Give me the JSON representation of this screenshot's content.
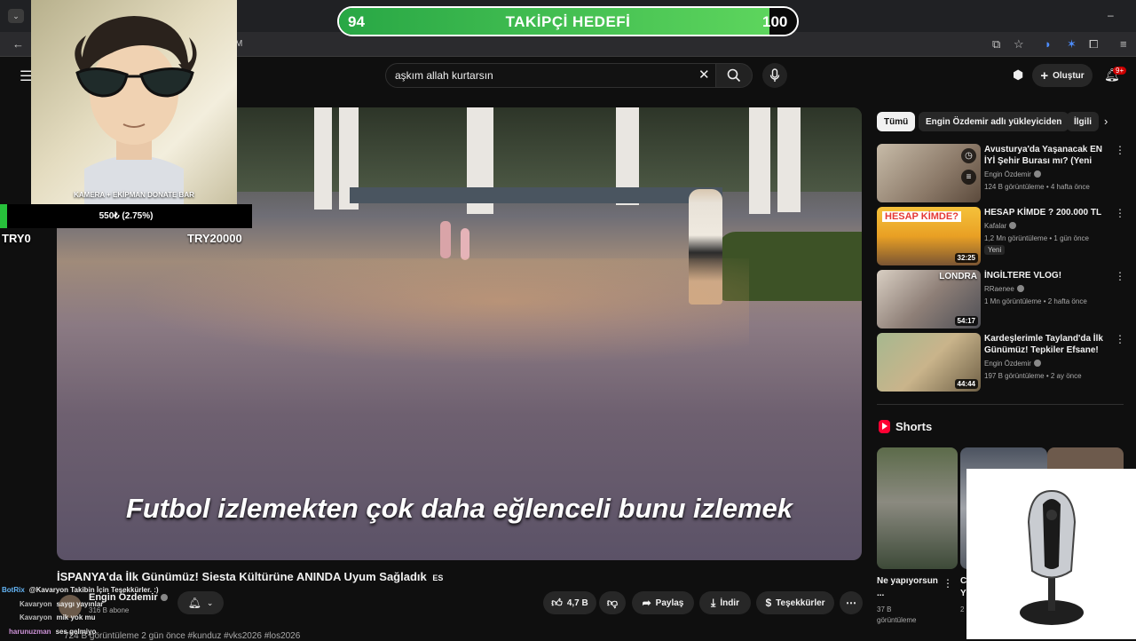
{
  "browser": {
    "address_suffix": "M"
  },
  "goal": {
    "title": "TAKİPÇİ HEDEFİ",
    "current": "94",
    "target": "100",
    "progress": 0.94
  },
  "search": {
    "query": "aşkım allah kurtarsın"
  },
  "header": {
    "create_label": "Oluştur",
    "notif_count": "9+"
  },
  "overlay": {
    "cam_caption": "KAMERA + EKİPMAN DONATE BAR",
    "donate_amount": "550₺ (2.75%)",
    "donate_progress": 0.0275,
    "min_label": "TRY0",
    "max_label": "TRY20000"
  },
  "video": {
    "subtitle": "Futbol izlemekten çok daha eğlenceli bunu izlemek",
    "title": "İSPANYA'da İlk Günümüz! Siesta Kültürüne ANINDA Uyum Sağladık",
    "title_suffix": "ES",
    "channel": "Engin Özdemir",
    "subscribers": "316 B abone",
    "description": "724 B görüntüleme  2 gün önce  #kunduz #vks2026 #los2026",
    "actions": {
      "likes": "4,7 B",
      "share": "Paylaş",
      "download": "İndir",
      "thanks": "Teşekkürler"
    }
  },
  "chips": [
    "Tümü",
    "Engin Özdemir adlı yükleyiciden",
    "İlgili"
  ],
  "recommendations": [
    {
      "title": "Avusturya'da Yaşanacak EN İYİ Şehir Burası mı? (Yeni Evimiz ...",
      "channel": "Engin Özdemir",
      "meta": "124 B görüntüleme • 4 hafta önce",
      "duration": "",
      "badge": ""
    },
    {
      "title": "HESAP KİMDE ? 200.000 TL",
      "channel": "Kafalar",
      "meta": "1,2 Mn görüntüleme • 1 gün önce",
      "duration": "32:25",
      "badge": "Yeni"
    },
    {
      "title": "İNGİLTERE VLOG!",
      "channel": "RRaenee",
      "meta": "1 Mn görüntüleme • 2 hafta önce",
      "duration": "54:17",
      "badge": ""
    },
    {
      "title": "Kardeşlerimle Tayland'da İlk Günümüz! Tepkiler Efsane!",
      "channel": "Engin Özdemir",
      "meta": "197 B görüntüleme • 2 ay önce",
      "duration": "44:44",
      "badge": ""
    }
  ],
  "thumb_texts": {
    "hesap": "HESAP KİMDE?",
    "londra": "LONDRA"
  },
  "shorts": {
    "heading": "Shorts",
    "items": [
      {
        "title": "Ne yapıyorsun ...",
        "views": "37 B görüntüleme"
      },
      {
        "title": "C Y",
        "views": "2"
      }
    ]
  },
  "chat": [
    {
      "user": "BotRix",
      "msg": "@Kavaryon Takibin İçin Teşekkürler. :)"
    },
    {
      "user": "Kavaryon",
      "msg": "saygı yayınlar"
    },
    {
      "user": "Kavaryon",
      "msg": "mik yok mu"
    },
    {
      "user": "harunuzman",
      "msg": "ses gelmiyo"
    }
  ],
  "colors": {
    "accent_red": "#cc0000",
    "goal_green": "#3cc24a",
    "yt_bg": "#0f0f0f"
  }
}
